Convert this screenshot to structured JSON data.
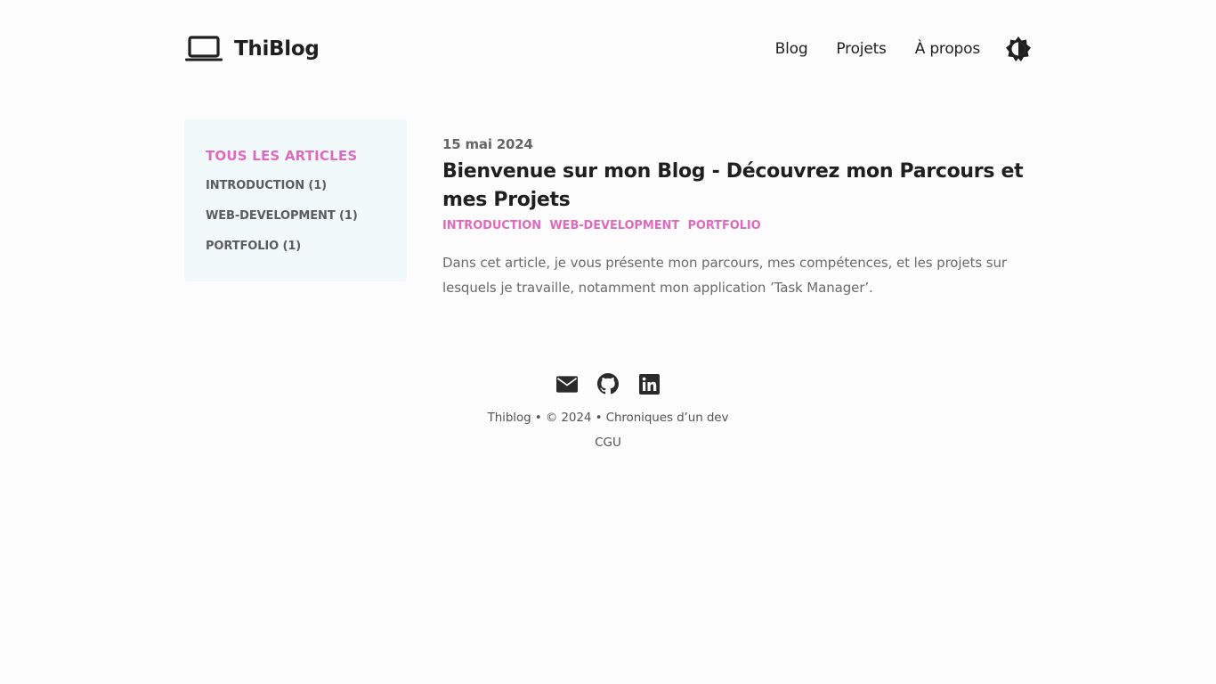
{
  "header": {
    "brand_name": "ThiBlog",
    "brand_icon": "laptop-icon",
    "nav": [
      "Blog",
      "Projets",
      "À propos"
    ],
    "theme_toggle_icon": "contrast-icon"
  },
  "sidebar": {
    "title": "TOUS LES ARTICLES",
    "items": [
      {
        "label": "INTRODUCTION (1)"
      },
      {
        "label": "WEB-DEVELOPMENT (1)"
      },
      {
        "label": "PORTFOLIO (1)"
      }
    ]
  },
  "post": {
    "date": "15 mai 2024",
    "title": "Bienvenue sur mon Blog - Découvrez mon Parcours et mes Projets",
    "tags": [
      "INTRODUCTION",
      "WEB-DEVELOPMENT",
      "PORTFOLIO"
    ],
    "excerpt": "Dans cet article, je vous présente mon parcours, mes compétences, et les projets sur lesquels je travaille, notamment mon application ’Task Manager’."
  },
  "footer": {
    "social_icons": [
      "email-icon",
      "github-icon",
      "linkedin-icon"
    ],
    "copyright": "Thiblog • © 2024 • Chroniques d’un dev",
    "cgu": "CGU"
  },
  "colors": {
    "accent": "#e06ac0",
    "sidebar_bg": "#f2f9fa",
    "page_bg": "#fdfdfd",
    "text": "#1f1f1f"
  }
}
